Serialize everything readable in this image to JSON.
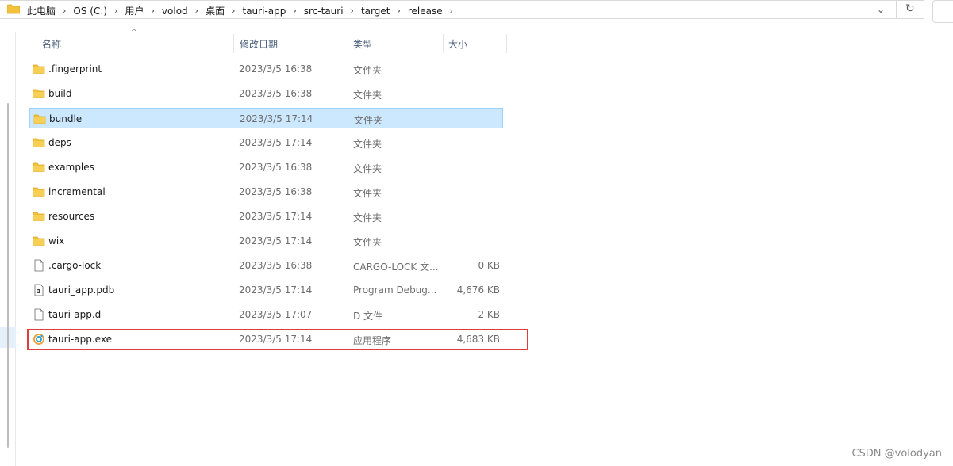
{
  "address_bar": {
    "breadcrumbs": [
      "此电脑",
      "OS (C:)",
      "用户",
      "volod",
      "桌面",
      "tauri-app",
      "src-tauri",
      "target",
      "release"
    ],
    "separator": "›",
    "dropdown_glyph": "⌄",
    "refresh_glyph": "↻"
  },
  "columns": {
    "name": "名称",
    "date": "修改日期",
    "type": "类型",
    "size": "大小",
    "sort_glyph": "^"
  },
  "files": [
    {
      "name": ".fingerprint",
      "date": "2023/3/5 16:38",
      "type": "文件夹",
      "size": "",
      "icon": "folder-icon"
    },
    {
      "name": "build",
      "date": "2023/3/5 16:38",
      "type": "文件夹",
      "size": "",
      "icon": "folder-icon"
    },
    {
      "name": "bundle",
      "date": "2023/3/5 17:14",
      "type": "文件夹",
      "size": "",
      "icon": "folder-icon",
      "selected": true
    },
    {
      "name": "deps",
      "date": "2023/3/5 17:14",
      "type": "文件夹",
      "size": "",
      "icon": "folder-icon"
    },
    {
      "name": "examples",
      "date": "2023/3/5 16:38",
      "type": "文件夹",
      "size": "",
      "icon": "folder-icon"
    },
    {
      "name": "incremental",
      "date": "2023/3/5 16:38",
      "type": "文件夹",
      "size": "",
      "icon": "folder-icon"
    },
    {
      "name": "resources",
      "date": "2023/3/5 17:14",
      "type": "文件夹",
      "size": "",
      "icon": "folder-icon"
    },
    {
      "name": "wix",
      "date": "2023/3/5 17:14",
      "type": "文件夹",
      "size": "",
      "icon": "folder-icon"
    },
    {
      "name": ".cargo-lock",
      "date": "2023/3/5 16:38",
      "type": "CARGO-LOCK 文...",
      "size": "0 KB",
      "icon": "file-icon"
    },
    {
      "name": "tauri_app.pdb",
      "date": "2023/3/5 17:14",
      "type": "Program Debug...",
      "size": "4,676 KB",
      "icon": "pdb-file-icon"
    },
    {
      "name": "tauri-app.d",
      "date": "2023/3/5 17:07",
      "type": "D 文件",
      "size": "2 KB",
      "icon": "file-icon"
    },
    {
      "name": "tauri-app.exe",
      "date": "2023/3/5 17:14",
      "type": "应用程序",
      "size": "4,683 KB",
      "icon": "exe-icon",
      "highlighted": true
    }
  ],
  "watermark": "CSDN @volodyan",
  "colors": {
    "folder": "#f3c23c",
    "selection_bg": "#cce8ff",
    "selection_border": "#99d1ff",
    "highlight_box": "#e03c3c"
  }
}
